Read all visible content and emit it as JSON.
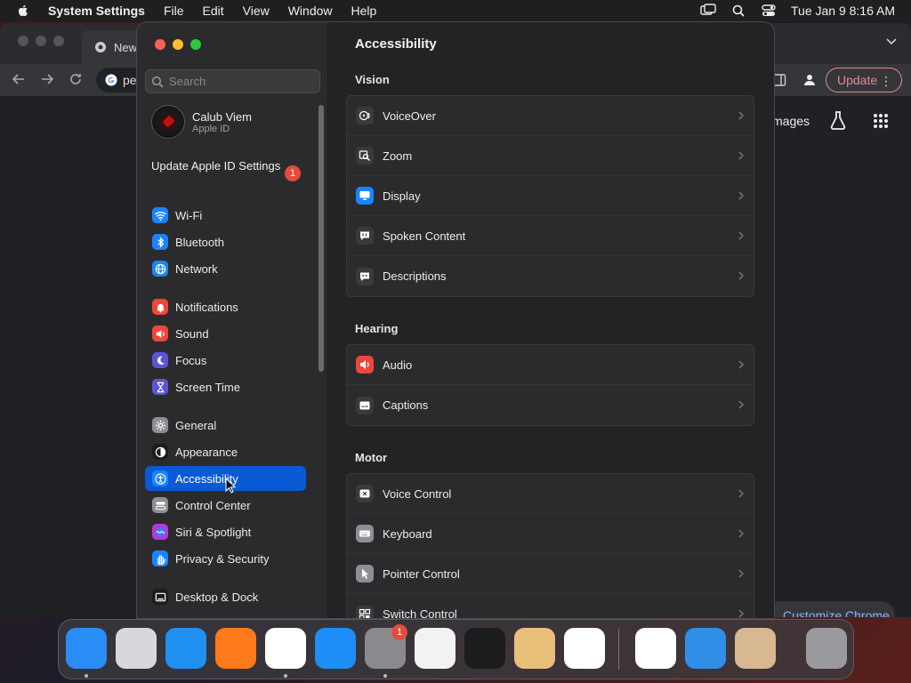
{
  "menubar": {
    "app_name": "System Settings",
    "items": [
      "File",
      "Edit",
      "View",
      "Window",
      "Help"
    ],
    "clock": "Tue Jan 9  8:16 AM"
  },
  "chrome": {
    "tab_title": "New",
    "omnibox_text": "pe",
    "update_label": "Update",
    "images_link": "mages",
    "customize_label": "Customize Chrome"
  },
  "sidebar": {
    "search_placeholder": "Search",
    "account": {
      "name": "Calub Viem",
      "subtitle": "Apple ID"
    },
    "update_apple_id": {
      "label": "Update Apple ID Settings",
      "badge": "1"
    },
    "items": [
      {
        "label": "Wi-Fi",
        "icon": "wifi-icon",
        "color": "#1a84ff"
      },
      {
        "label": "Bluetooth",
        "icon": "bluetooth-icon",
        "color": "#1a84ff"
      },
      {
        "label": "Network",
        "icon": "globe-icon",
        "color": "#1a84ff"
      },
      {
        "label": "Notifications",
        "icon": "bell-icon",
        "color": "#f0453a"
      },
      {
        "label": "Sound",
        "icon": "speaker-icon",
        "color": "#f0453a"
      },
      {
        "label": "Focus",
        "icon": "moon-icon",
        "color": "#5b55d6"
      },
      {
        "label": "Screen Time",
        "icon": "hourglass-icon",
        "color": "#5b55d6"
      },
      {
        "label": "General",
        "icon": "gear-icon",
        "color": "#8e8e93"
      },
      {
        "label": "Appearance",
        "icon": "appearance-icon",
        "color": "#1c1c1e"
      },
      {
        "label": "Accessibility",
        "icon": "accessibility-icon",
        "color": "#1a84ff",
        "selected": true
      },
      {
        "label": "Control Center",
        "icon": "control-center-icon",
        "color": "#8e8e93"
      },
      {
        "label": "Siri & Spotlight",
        "icon": "siri-icon",
        "color": "#b23ad6"
      },
      {
        "label": "Privacy & Security",
        "icon": "hand-icon",
        "color": "#1a84ff"
      },
      {
        "label": "Desktop & Dock",
        "icon": "dock-icon",
        "color": "#1c1c1e"
      }
    ]
  },
  "content": {
    "title": "Accessibility",
    "sections": [
      {
        "heading": "Vision",
        "rows": [
          {
            "label": "VoiceOver",
            "icon": "voiceover-icon",
            "color": "#3a3a3c"
          },
          {
            "label": "Zoom",
            "icon": "zoom-icon",
            "color": "#3a3a3c"
          },
          {
            "label": "Display",
            "icon": "display-icon",
            "color": "#1a84ff"
          },
          {
            "label": "Spoken Content",
            "icon": "speech-bubble-icon",
            "color": "#3a3a3c"
          },
          {
            "label": "Descriptions",
            "icon": "quote-bubble-icon",
            "color": "#3a3a3c"
          }
        ]
      },
      {
        "heading": "Hearing",
        "rows": [
          {
            "label": "Audio",
            "icon": "speaker-icon",
            "color": "#f0453a"
          },
          {
            "label": "Captions",
            "icon": "captions-icon",
            "color": "#3a3a3c"
          }
        ]
      },
      {
        "heading": "Motor",
        "rows": [
          {
            "label": "Voice Control",
            "icon": "voice-control-icon",
            "color": "#3a3a3c"
          },
          {
            "label": "Keyboard",
            "icon": "keyboard-icon",
            "color": "#8e8e93"
          },
          {
            "label": "Pointer Control",
            "icon": "pointer-icon",
            "color": "#8e8e93"
          },
          {
            "label": "Switch Control",
            "icon": "switch-control-icon",
            "color": "#3a3a3c"
          }
        ]
      }
    ]
  },
  "dock": {
    "apps": [
      {
        "name": "finder-icon",
        "color": "#2a8cf5",
        "running": true
      },
      {
        "name": "launchpad-icon",
        "color": "#d8d8dc",
        "running": false
      },
      {
        "name": "safari-icon",
        "color": "#1f8ff0",
        "running": false
      },
      {
        "name": "firefox-icon",
        "color": "#ff7a1a",
        "running": false
      },
      {
        "name": "chrome-icon",
        "color": "#ffffff",
        "running": true
      },
      {
        "name": "app-store-icon",
        "color": "#1c8ef5",
        "running": false
      },
      {
        "name": "system-settings-icon",
        "color": "#8a8a8e",
        "running": true,
        "badge": "1"
      },
      {
        "name": "textedit-icon",
        "color": "#f2f2f2",
        "running": false
      },
      {
        "name": "terminal-icon",
        "color": "#1c1c1e",
        "running": false
      },
      {
        "name": "garageband-icon",
        "color": "#e8c07a",
        "running": false
      },
      {
        "name": "vscode-icon",
        "color": "#ffffff",
        "running": false
      },
      {
        "name": "visual-studio-icon",
        "color": "#ffffff",
        "running": false
      },
      {
        "name": "weather-icon",
        "color": "#2f8ee6",
        "running": false
      },
      {
        "name": "color-palette-icon",
        "color": "#d8b890",
        "running": false
      },
      {
        "name": "trash-icon",
        "color": "#9a9a9e",
        "running": false
      }
    ]
  }
}
